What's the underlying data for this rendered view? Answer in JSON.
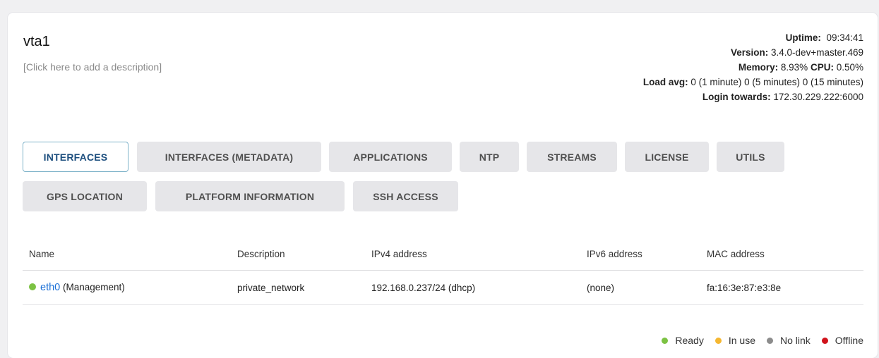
{
  "device": {
    "name": "vta1",
    "description_placeholder": "[Click here to add a description]"
  },
  "info": {
    "uptime_label": "Uptime:",
    "uptime_value": "09:34:41",
    "version_label": "Version:",
    "version_value": "3.4.0-dev+master.469",
    "memory_label": "Memory:",
    "memory_value": "8.93%",
    "cpu_label": "CPU:",
    "cpu_value": "0.50%",
    "load_label": "Load avg:",
    "load_value": "0 (1 minute) 0 (5 minutes) 0 (15 minutes)",
    "login_label": "Login towards:",
    "login_value": "172.30.229.222:6000"
  },
  "tabs": [
    {
      "label": "INTERFACES",
      "active": true
    },
    {
      "label": "INTERFACES (METADATA)"
    },
    {
      "label": "APPLICATIONS"
    },
    {
      "label": "NTP"
    },
    {
      "label": "STREAMS"
    },
    {
      "label": "LICENSE"
    },
    {
      "label": "UTILS"
    },
    {
      "label": "GPS LOCATION"
    },
    {
      "label": "PLATFORM INFORMATION"
    },
    {
      "label": "SSH ACCESS"
    }
  ],
  "table": {
    "headers": [
      "Name",
      "Description",
      "IPv4 address",
      "IPv6 address",
      "MAC address"
    ],
    "rows": [
      {
        "status": "ready",
        "name": "eth0",
        "role": "(Management)",
        "description": "private_network",
        "ipv4": "192.168.0.237/24 (dhcp)",
        "ipv6": "(none)",
        "mac": "fa:16:3e:87:e3:8e"
      }
    ]
  },
  "legend": [
    {
      "label": "Ready",
      "color": "#7cc243"
    },
    {
      "label": "In use",
      "color": "#f5b731"
    },
    {
      "label": "No link",
      "color": "#8c8c8c"
    },
    {
      "label": "Offline",
      "color": "#d0121b"
    }
  ],
  "colors": {
    "status_ready": "#7cc243",
    "link": "#1a6fd6",
    "active_tab_border": "#7fb3c9"
  }
}
